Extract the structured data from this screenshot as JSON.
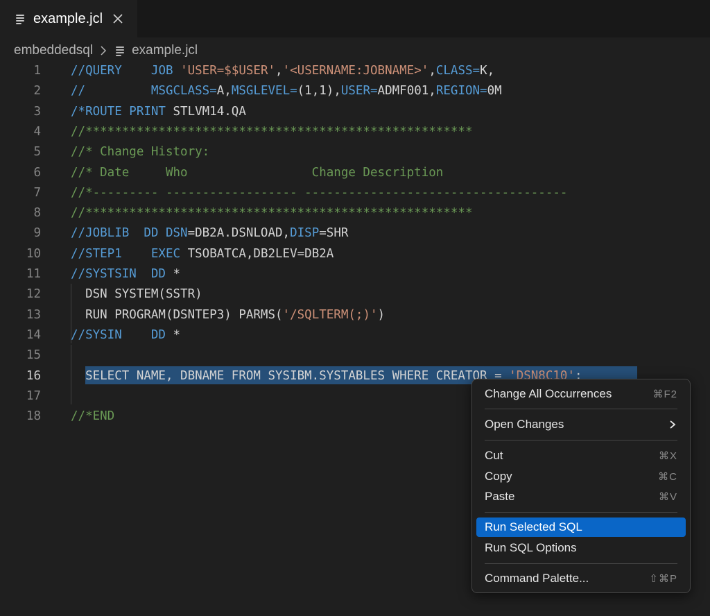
{
  "tab": {
    "title": "example.jcl",
    "close_icon": "close-icon"
  },
  "breadcrumb": {
    "folder": "embeddedsql",
    "file": "example.jcl"
  },
  "editor": {
    "active_line": "16",
    "lines": [
      {
        "num": "1",
        "segments": [
          [
            "kw",
            "//QUERY"
          ],
          [
            "pl",
            "    "
          ],
          [
            "kw",
            "JOB "
          ],
          [
            "str",
            "'USER=$$USER'"
          ],
          [
            "pl",
            ","
          ],
          [
            "str",
            "'<USERNAME:JOBNAME>'"
          ],
          [
            "pl",
            ","
          ],
          [
            "kw",
            "CLASS="
          ],
          [
            "pl",
            "K,"
          ]
        ]
      },
      {
        "num": "2",
        "segments": [
          [
            "kw",
            "//"
          ],
          [
            "pl",
            "         "
          ],
          [
            "kw",
            "MSGCLASS="
          ],
          [
            "pl",
            "A,"
          ],
          [
            "kw",
            "MSGLEVEL="
          ],
          [
            "pl",
            "(1,1),"
          ],
          [
            "kw",
            "USER="
          ],
          [
            "pl",
            "ADMF001,"
          ],
          [
            "kw",
            "REGION="
          ],
          [
            "pl",
            "0M"
          ]
        ]
      },
      {
        "num": "3",
        "segments": [
          [
            "kw",
            "/*ROUTE PRINT"
          ],
          [
            "pl",
            " STLVM14.QA"
          ]
        ]
      },
      {
        "num": "4",
        "segments": [
          [
            "cm",
            "//*****************************************************"
          ]
        ]
      },
      {
        "num": "5",
        "segments": [
          [
            "cm",
            "//* Change History:"
          ]
        ]
      },
      {
        "num": "6",
        "segments": [
          [
            "cm",
            "//* Date     Who                 Change Description"
          ]
        ]
      },
      {
        "num": "7",
        "segments": [
          [
            "cm",
            "//*--------- ------------------ ------------------------------------"
          ]
        ]
      },
      {
        "num": "8",
        "segments": [
          [
            "cm",
            "//*****************************************************"
          ]
        ]
      },
      {
        "num": "9",
        "segments": [
          [
            "kw",
            "//JOBLIB  DD DSN"
          ],
          [
            "pl",
            "=DB2A.DSNLOAD,"
          ],
          [
            "kw",
            "DISP"
          ],
          [
            "pl",
            "=SHR"
          ]
        ]
      },
      {
        "num": "10",
        "segments": [
          [
            "kw",
            "//STEP1    EXEC"
          ],
          [
            "pl",
            " TSOBATCA,DB2LEV=DB2A"
          ]
        ]
      },
      {
        "num": "11",
        "segments": [
          [
            "kw",
            "//SYSTSIN  DD"
          ],
          [
            "pl",
            " *"
          ]
        ]
      },
      {
        "num": "12",
        "segments": [
          [
            "pl",
            "  DSN SYSTEM(SSTR)"
          ]
        ]
      },
      {
        "num": "13",
        "segments": [
          [
            "pl",
            "  RUN PROGRAM(DSNTEP3) PARMS("
          ],
          [
            "str",
            "'/SQLTERM(;)'"
          ],
          [
            "pl",
            ")"
          ]
        ]
      },
      {
        "num": "14",
        "segments": [
          [
            "kw",
            "//SYSIN    DD"
          ],
          [
            "pl",
            " *"
          ]
        ]
      },
      {
        "num": "15",
        "segments": []
      },
      {
        "num": "16",
        "segments": [
          [
            "pl",
            "  SELECT NAME, DBNAME FROM SYSIBM.SYSTABLES WHERE CREATOR = "
          ],
          [
            "str",
            "'DSN8C10'"
          ],
          [
            "pl",
            ";"
          ]
        ]
      },
      {
        "num": "17",
        "segments": []
      },
      {
        "num": "18",
        "segments": [
          [
            "cm",
            "//*END"
          ]
        ]
      }
    ]
  },
  "context_menu": {
    "change_all": {
      "label": "Change All Occurrences",
      "shortcut": "⌘F2"
    },
    "open_changes": {
      "label": "Open Changes",
      "icon": "chevron-right-icon"
    },
    "cut": {
      "label": "Cut",
      "shortcut": "⌘X"
    },
    "copy": {
      "label": "Copy",
      "shortcut": "⌘C"
    },
    "paste": {
      "label": "Paste",
      "shortcut": "⌘V"
    },
    "run_selected_sql": {
      "label": "Run Selected SQL"
    },
    "run_sql_options": {
      "label": "Run SQL Options"
    },
    "command_palette": {
      "label": "Command Palette...",
      "shortcut": "⇧⌘P"
    }
  },
  "colors": {
    "keyword": "#569cd6",
    "string": "#ce9178",
    "comment": "#6a9955",
    "selection": "#264f78",
    "menu_highlight": "#0a66c7"
  }
}
